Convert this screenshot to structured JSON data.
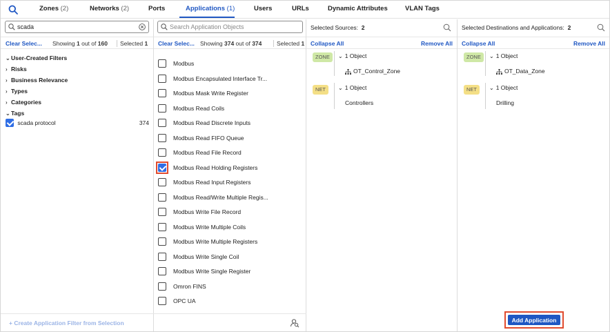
{
  "tabs": [
    {
      "label": "Zones",
      "count": "(2)"
    },
    {
      "label": "Networks",
      "count": "(2)"
    },
    {
      "label": "Ports",
      "count": ""
    },
    {
      "label": "Applications",
      "count": "(1)"
    },
    {
      "label": "Users",
      "count": ""
    },
    {
      "label": "URLs",
      "count": ""
    },
    {
      "label": "Dynamic Attributes",
      "count": ""
    },
    {
      "label": "VLAN Tags",
      "count": ""
    }
  ],
  "filters": {
    "search_value": "scada",
    "clear_label": "Clear Selec...",
    "showing_prefix": "Showing",
    "showing_n": "1",
    "showing_mid": "out of",
    "showing_total": "160",
    "selected_label": "Selected",
    "selected_n": "1",
    "sections": [
      "User-Created Filters",
      "Risks",
      "Business Relevance",
      "Types",
      "Categories",
      "Tags"
    ],
    "tag_item": {
      "label": "scada protocol",
      "count": "374"
    },
    "create_filter_label": "+ Create Application Filter from Selection"
  },
  "apps": {
    "search_placeholder": "Search Application Objects",
    "clear_label": "Clear Selec...",
    "showing_prefix": "Showing",
    "showing_n": "374",
    "showing_mid": "out of",
    "showing_total": "374",
    "selected_label": "Selected",
    "selected_n": "1",
    "items": [
      {
        "label": "Modbus",
        "checked": false
      },
      {
        "label": "Modbus Encapsulated Interface Tr...",
        "checked": false
      },
      {
        "label": "Modbus Mask Write Register",
        "checked": false
      },
      {
        "label": "Modbus Read Coils",
        "checked": false
      },
      {
        "label": "Modbus Read Discrete Inputs",
        "checked": false
      },
      {
        "label": "Modbus Read FIFO Queue",
        "checked": false
      },
      {
        "label": "Modbus Read File Record",
        "checked": false
      },
      {
        "label": "Modbus Read Holding Registers",
        "checked": true
      },
      {
        "label": "Modbus Read Input Registers",
        "checked": false
      },
      {
        "label": "Modbus Read/Write Multiple Regis...",
        "checked": false
      },
      {
        "label": "Modbus Write File Record",
        "checked": false
      },
      {
        "label": "Modbus Write Multiple Coils",
        "checked": false
      },
      {
        "label": "Modbus Write Multiple Registers",
        "checked": false
      },
      {
        "label": "Modbus Write Single Coil",
        "checked": false
      },
      {
        "label": "Modbus Write Single Register",
        "checked": false
      },
      {
        "label": "Omron FINS",
        "checked": false
      },
      {
        "label": "OPC UA",
        "checked": false
      }
    ]
  },
  "sources": {
    "title": "Selected Sources:",
    "count": "2",
    "collapse_all": "Collapse All",
    "remove_all": "Remove All",
    "groups": [
      {
        "badge": "ZONE",
        "count_label": "1 Object",
        "item": "OT_Control_Zone"
      },
      {
        "badge": "NET",
        "count_label": "1 Object",
        "item": "Controllers"
      }
    ]
  },
  "destinations": {
    "title": "Selected Destinations and Applications:",
    "count": "2",
    "collapse_all": "Collapse All",
    "remove_all": "Remove All",
    "groups": [
      {
        "badge": "ZONE",
        "count_label": "1 Object",
        "item": "OT_Data_Zone"
      },
      {
        "badge": "NET",
        "count_label": "1 Object",
        "item": "Drilling"
      }
    ],
    "add_button": "Add Application"
  },
  "colors": {
    "accent": "#1f57c3",
    "highlight": "#e04b2e",
    "zone_badge": "#cfe8a6",
    "net_badge": "#f4df86",
    "checkbox_checked": "#2f6ee5"
  }
}
